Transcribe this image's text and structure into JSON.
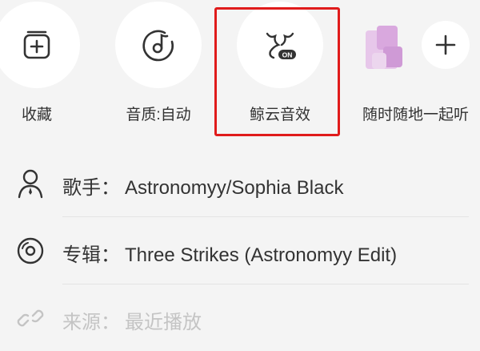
{
  "actions": {
    "collect": {
      "label": "收藏",
      "icon": "add-to-collection-icon"
    },
    "quality": {
      "label": "音质:自动",
      "icon": "music-disc-icon"
    },
    "effect": {
      "label": "鲸云音效",
      "icon": "whale-sound-effect-icon",
      "badge": "ON"
    },
    "listen_together": {
      "label": "随时随地一起听",
      "icon": "plus-icon"
    }
  },
  "info": {
    "artist": {
      "label": "歌手",
      "value": "Astronomyy/Sophia Black",
      "icon": "person-icon"
    },
    "album": {
      "label": "专辑",
      "value": "Three Strikes (Astronomyy Edit)",
      "icon": "album-icon"
    },
    "source": {
      "label": "来源",
      "value": "最近播放",
      "icon": "link-icon"
    }
  },
  "colors": {
    "highlight": "#e01b1b",
    "background": "#f4f4f4",
    "muted_text": "#c4c4c4"
  }
}
